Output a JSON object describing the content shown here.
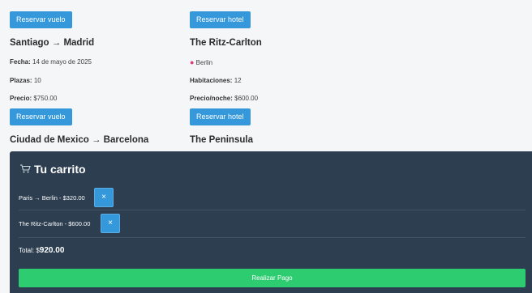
{
  "flights": [
    {
      "button": "Reservar vuelo"
    },
    {
      "route": "Santiago → Madrid",
      "fecha_label": "Fecha:",
      "fecha": "14 de mayo de 2025",
      "plazas_label": "Plazas:",
      "plazas": "10",
      "precio_label": "Precio:",
      "precio": "$750.00",
      "button": "Reservar vuelo"
    },
    {
      "route": "Ciudad de Mexico → Barcelona"
    }
  ],
  "hotels": [
    {
      "button": "Reservar hotel"
    },
    {
      "name": "The Ritz-Carlton",
      "city": "Berlin",
      "hab_label": "Habitaciones:",
      "habitaciones": "12",
      "precio_label": "Precio/noche:",
      "precio": "$600.00",
      "button": "Reservar hotel"
    },
    {
      "name": "The Peninsula"
    }
  ],
  "cart": {
    "icon": "cart-icon",
    "title": "Tu carrito",
    "items": [
      {
        "text": "Paris → Berlin - $320.00",
        "remove": "×"
      },
      {
        "text": "The Ritz-Carlton - $600.00",
        "remove": "×"
      }
    ],
    "total_label": "Total: $",
    "total_value": "920.00",
    "pay_button": "Realizar Pago"
  },
  "colors": {
    "primary": "#3498db",
    "success": "#2ecc71",
    "cart_bg": "#2c3e50"
  }
}
